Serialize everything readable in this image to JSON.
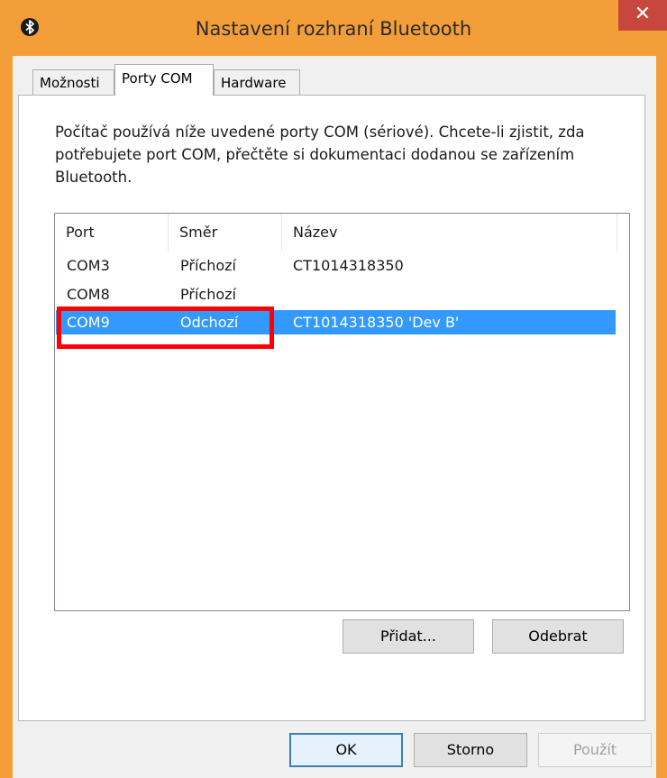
{
  "window": {
    "title": "Nastavení rozhraní Bluetooth",
    "close_label": "✕"
  },
  "tabs": [
    {
      "label": "Možnosti",
      "active": false
    },
    {
      "label": "Porty COM",
      "active": true
    },
    {
      "label": "Hardware",
      "active": false
    }
  ],
  "description": "Počítač používá níže uvedené porty COM (sériové). Chcete-li zjistit, zda potřebujete port COM, přečtěte si dokumentaci dodanou se zařízením Bluetooth.",
  "table": {
    "columns": [
      "Port",
      "Směr",
      "Název"
    ],
    "rows": [
      {
        "port": "COM3",
        "direction": "Příchozí",
        "name": "CT1014318350",
        "selected": false
      },
      {
        "port": "COM8",
        "direction": "Příchozí",
        "name": "",
        "selected": false
      },
      {
        "port": "COM9",
        "direction": "Odchozí",
        "name": "CT1014318350 'Dev B'",
        "selected": true
      }
    ]
  },
  "buttons": {
    "add": "Přidat...",
    "remove": "Odebrat",
    "ok": "OK",
    "cancel": "Storno",
    "apply": "Použít"
  },
  "colors": {
    "titlebar": "#f39e38",
    "close": "#c7463e",
    "selection": "#3399ff",
    "highlight": "#ff0000"
  },
  "icons": {
    "app": "bluetooth-icon",
    "close": "close-icon"
  }
}
